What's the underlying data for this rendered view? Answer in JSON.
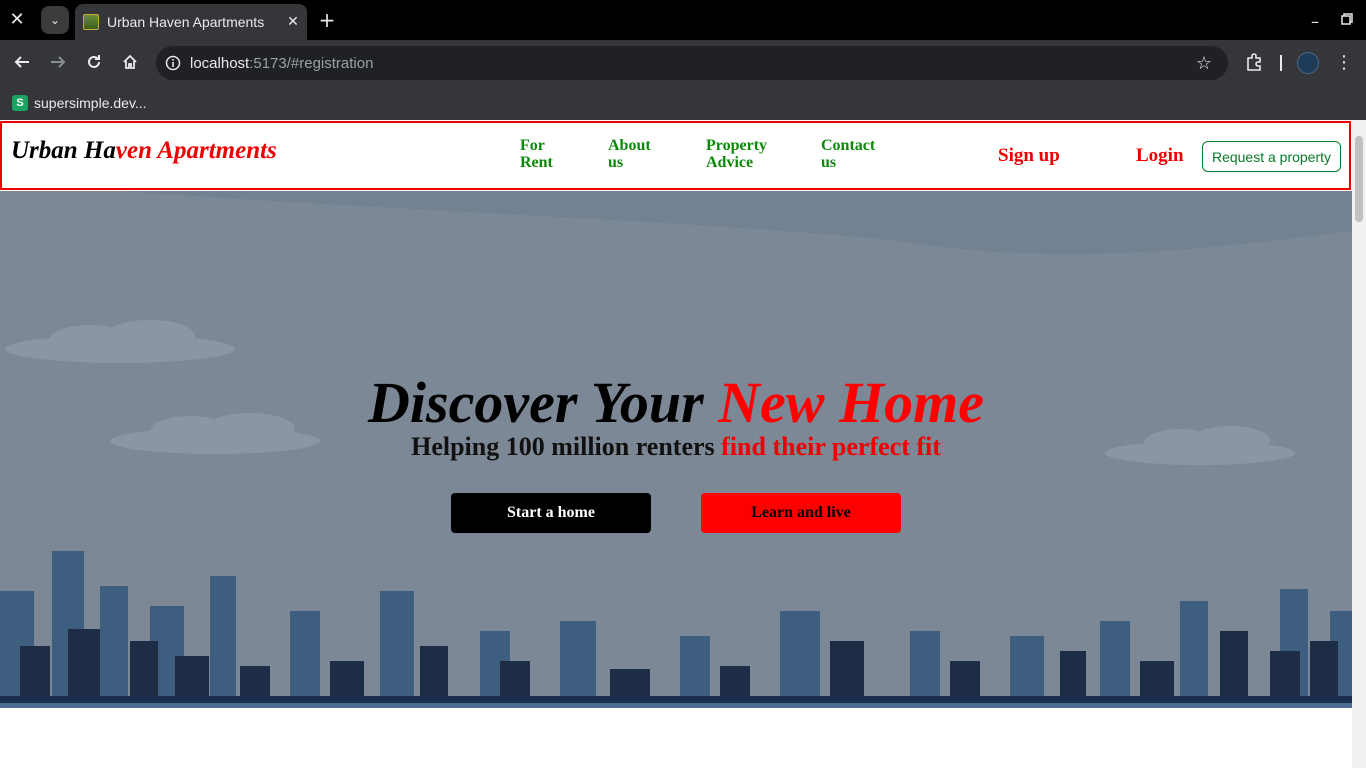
{
  "browser": {
    "tab_title": "Urban Haven Apartments",
    "url_host": "localhost",
    "url_rest": ":5173/#registration",
    "bookmark_label": "supersimple.dev..."
  },
  "navbar": {
    "brand_black": "Urban Ha",
    "brand_red": "ven Apartments",
    "links": [
      "For\nRent",
      "About\nus",
      "Property\nAdvice",
      "Contact\nus"
    ],
    "signup": "Sign up",
    "login": "Login",
    "request_button": "Request a property"
  },
  "hero": {
    "title_black": "Discover Your ",
    "title_red": "New Home",
    "subtitle_black": "Helping 100 million renters ",
    "subtitle_red": "find their perfect fit",
    "primary_button": "Start a home",
    "secondary_button": "Learn and live"
  },
  "colors": {
    "brand_red": "#e00000",
    "nav_green": "#0a8a0a",
    "hero_bg": "#7d8896"
  }
}
